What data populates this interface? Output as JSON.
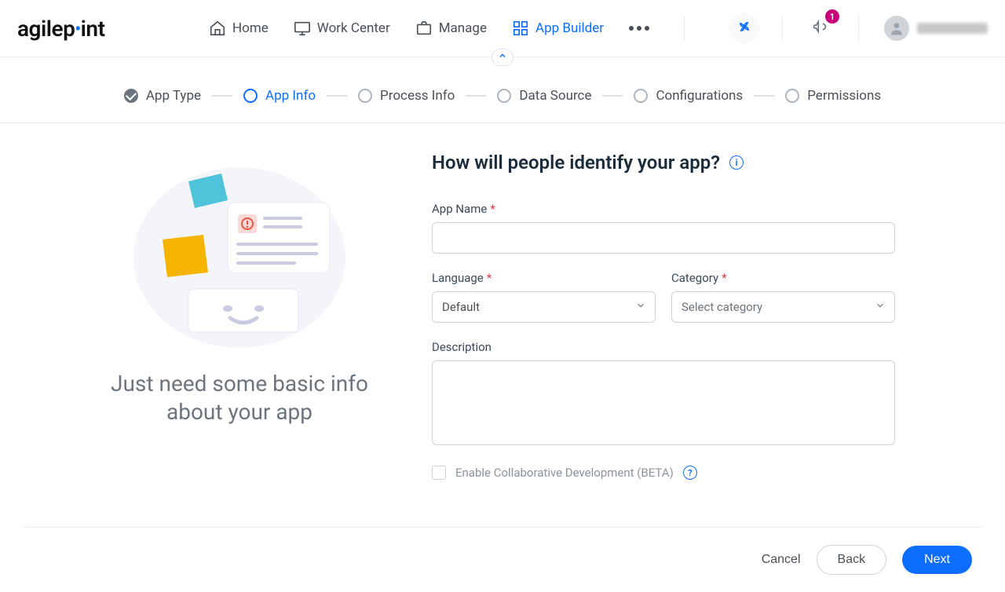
{
  "brand": {
    "prefix": "agilep",
    "accent": "•",
    "suffix": "int"
  },
  "nav": {
    "items": [
      {
        "label": "Home"
      },
      {
        "label": "Work Center"
      },
      {
        "label": "Manage"
      },
      {
        "label": "App Builder"
      }
    ]
  },
  "notifications": {
    "count": "1"
  },
  "stepper": [
    {
      "label": "App Type",
      "state": "done"
    },
    {
      "label": "App Info",
      "state": "current"
    },
    {
      "label": "Process Info",
      "state": "pending"
    },
    {
      "label": "Data Source",
      "state": "pending"
    },
    {
      "label": "Configurations",
      "state": "pending"
    },
    {
      "label": "Permissions",
      "state": "pending"
    }
  ],
  "left": {
    "title": "Just need some basic info about your app"
  },
  "form": {
    "heading": "How will people identify your app?",
    "appName": {
      "label": "App Name",
      "value": ""
    },
    "language": {
      "label": "Language",
      "value": "Default"
    },
    "category": {
      "label": "Category",
      "placeholder": "Select category"
    },
    "description": {
      "label": "Description",
      "value": ""
    },
    "collab": {
      "label": "Enable Collaborative Development (BETA)"
    }
  },
  "footer": {
    "cancel": "Cancel",
    "back": "Back",
    "next": "Next"
  }
}
